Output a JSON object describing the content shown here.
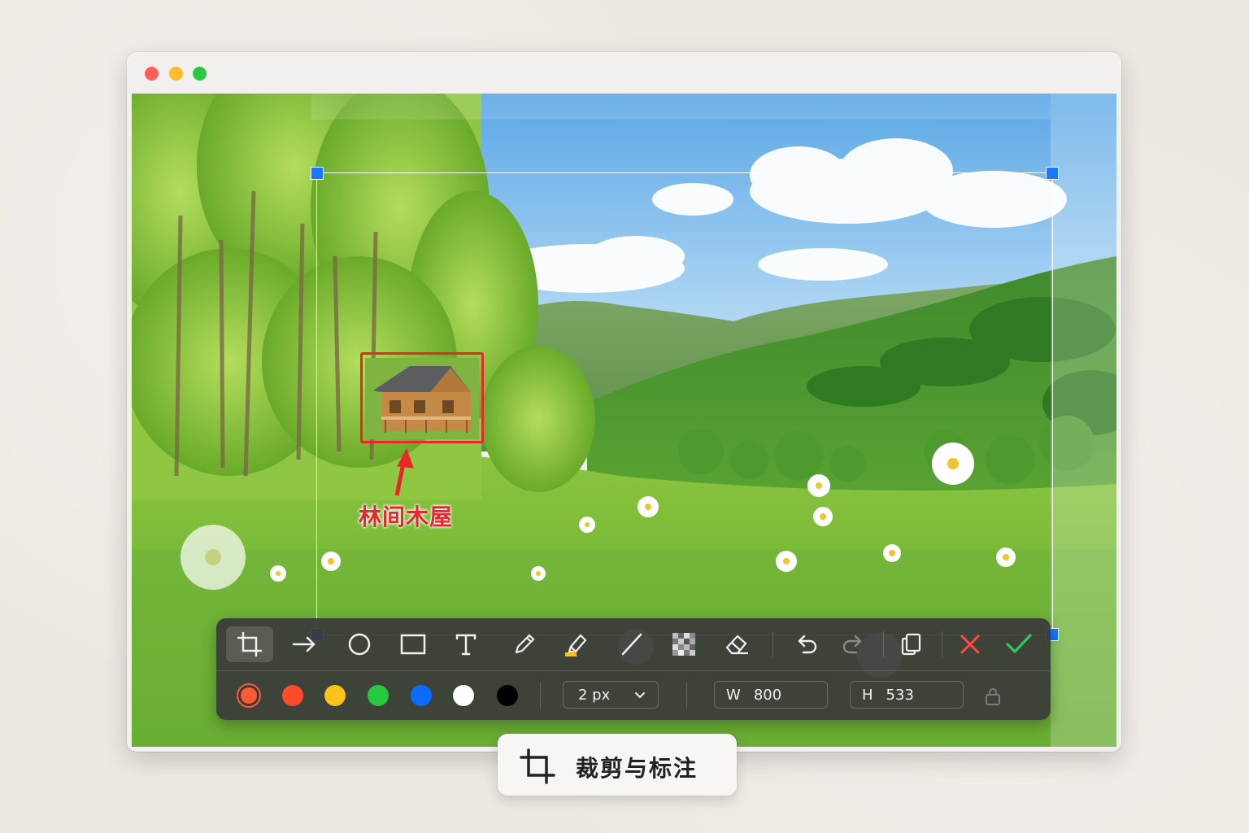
{
  "window": {
    "controls": [
      "close",
      "minimize",
      "zoom"
    ]
  },
  "image": {
    "annotation": {
      "label": "林间木屋"
    }
  },
  "toolbar": {
    "tools": [
      {
        "name": "crop",
        "icon": "crop-icon",
        "active": true
      },
      {
        "name": "arrow",
        "icon": "arrow-right-icon"
      },
      {
        "name": "ellipse",
        "icon": "circle-icon"
      },
      {
        "name": "rectangle",
        "icon": "rectangle-icon"
      },
      {
        "name": "text",
        "icon": "text-icon",
        "glyph": "T"
      },
      {
        "name": "pencil",
        "icon": "pencil-icon"
      },
      {
        "name": "highlighter",
        "icon": "highlighter-icon"
      },
      {
        "name": "line",
        "icon": "line-icon"
      },
      {
        "name": "mosaic",
        "icon": "mosaic-icon"
      },
      {
        "name": "eraser",
        "icon": "eraser-icon"
      },
      {
        "name": "undo",
        "icon": "undo-icon"
      },
      {
        "name": "redo",
        "icon": "redo-icon",
        "disabled": true
      },
      {
        "name": "copy",
        "icon": "copy-icon"
      },
      {
        "name": "cancel",
        "icon": "close-icon",
        "color": "#ff4a3d"
      },
      {
        "name": "confirm",
        "icon": "check-icon",
        "color": "#34c759"
      }
    ],
    "colors": [
      {
        "name": "red",
        "hex": "#ff5a36",
        "selected": true
      },
      {
        "name": "orange-red",
        "hex": "#ff4a2e"
      },
      {
        "name": "yellow",
        "hex": "#ffc21a"
      },
      {
        "name": "green",
        "hex": "#28c840"
      },
      {
        "name": "blue",
        "hex": "#0a6cff"
      },
      {
        "name": "white",
        "hex": "#ffffff"
      },
      {
        "name": "black",
        "hex": "#000000"
      }
    ],
    "stroke_width": "2 px",
    "width_label": "W",
    "width_value": "800",
    "height_label": "H",
    "height_value": "533",
    "lock_icon": "lock-icon"
  },
  "caption": {
    "icon": "crop-icon",
    "text": "裁剪与标注"
  },
  "accent_colors": {
    "handle": "#1677ff",
    "annotation": "#e8262b",
    "cancel": "#ff4a3d",
    "confirm": "#34c759"
  }
}
